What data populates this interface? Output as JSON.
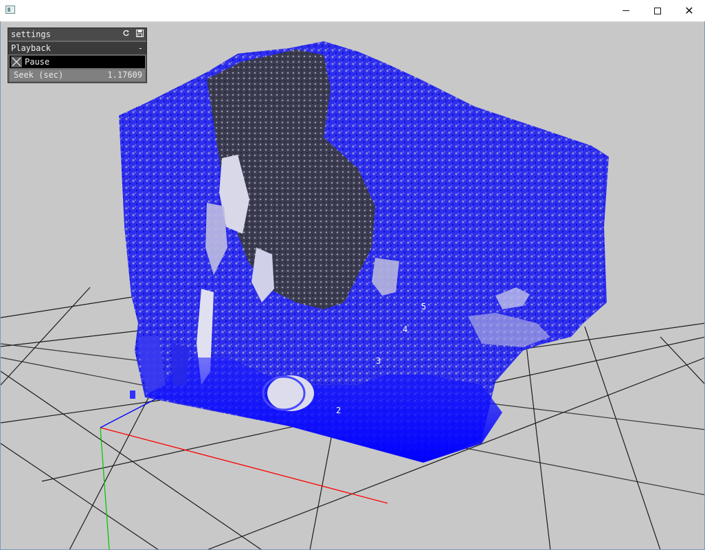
{
  "window": {
    "title": "",
    "minimize_glyph": "─",
    "close_glyph": "✕"
  },
  "panel": {
    "title": "settings",
    "refresh_icon": "refresh-icon",
    "save_icon": "save-icon",
    "group": {
      "label": "Playback",
      "collapse_glyph": "-"
    },
    "pause": {
      "label": "Pause",
      "checked": true
    },
    "seek": {
      "label": "Seek (sec)",
      "value": "1.17609"
    }
  },
  "scene": {
    "grid_labels": [
      "2",
      "3",
      "4",
      "5"
    ],
    "axis_colors": {
      "x": "#ff0000",
      "y": "#00cc00",
      "z": "#0000ff"
    },
    "cloud_color": "#1a1aff",
    "background": "#c8c8c8"
  }
}
